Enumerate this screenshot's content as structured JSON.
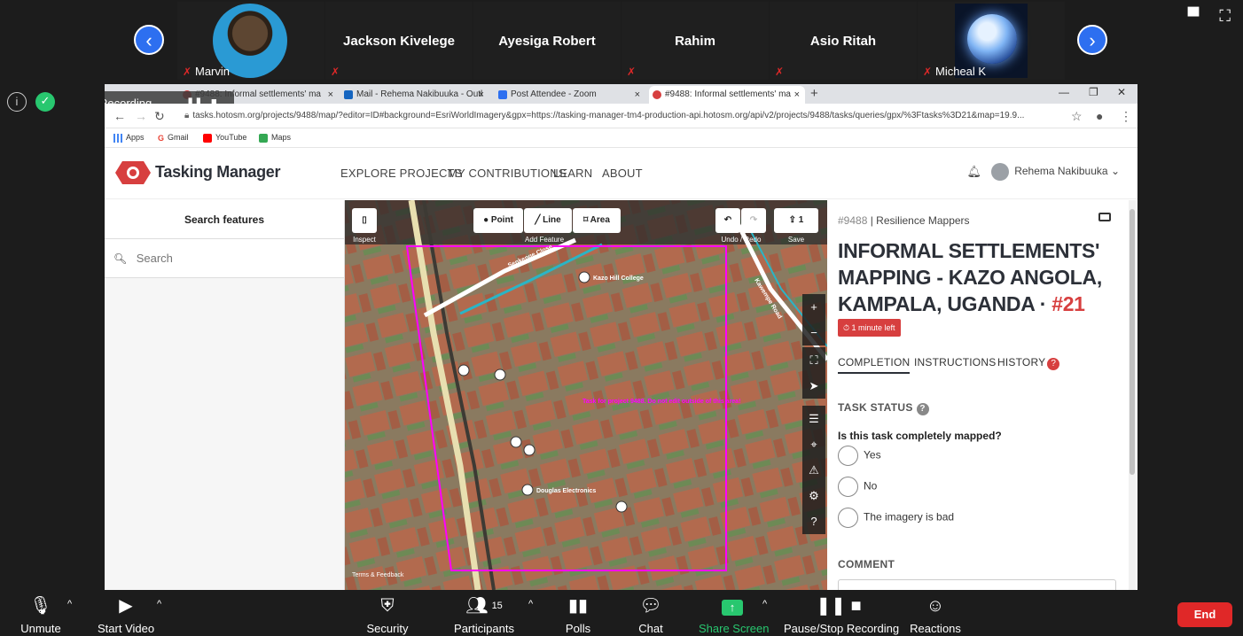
{
  "gallery": {
    "participants": [
      {
        "name": "Marvin",
        "has_video": true
      },
      {
        "name": "Jackson Kivelege"
      },
      {
        "name": "Ayesiga Robert"
      },
      {
        "name": "Rahim"
      },
      {
        "name": "Asio Ritah"
      },
      {
        "name": "Micheal K",
        "has_video": true
      }
    ],
    "prev_arrow": "‹",
    "next_arrow": "›"
  },
  "recording": {
    "label": "Recording..."
  },
  "browser": {
    "tabs": [
      {
        "label": "#9488: Informal settlements' ma"
      },
      {
        "label": "Mail - Rehema Nakibuuka - Outl"
      },
      {
        "label": "Post Attendee - Zoom"
      },
      {
        "label": "#9488: Informal settlements' ma"
      }
    ],
    "new_tab": "+",
    "url": "tasks.hotosm.org/projects/9488/map/?editor=ID#background=EsriWorldImagery&gpx=https://tasking-manager-tm4-production-api.hotosm.org/api/v2/projects/9488/tasks/queries/gpx/%3Ftasks%3D21&map=19.9...",
    "bookmarks": [
      {
        "label": "Apps",
        "color": "#4285f4"
      },
      {
        "label": "Gmail",
        "color": "#ea4335"
      },
      {
        "label": "YouTube",
        "color": "#ff0000"
      },
      {
        "label": "Maps",
        "color": "#34a853"
      }
    ]
  },
  "tm": {
    "title": "Tasking Manager",
    "nav": [
      "EXPLORE PROJECTS",
      "MY CONTRIBUTIONS",
      "LEARN",
      "ABOUT"
    ],
    "user_name": "Rehema Nakibuuka"
  },
  "search": {
    "header": "Search features",
    "placeholder": "Search"
  },
  "map": {
    "inspect_label": "Inspect",
    "point_label": "Point",
    "line_label": "Line",
    "area_label": "Area",
    "add_feature_label": "Add Feature",
    "undo_redo_label": "Undo / Redo",
    "save_label": "Save",
    "save_count": "1",
    "task_warning": "Task for project 9488. Do not edit outside of this area!",
    "poi_labels": [
      "Kazo Hill College",
      "Douglas Electronics"
    ],
    "road_labels": [
      "Senkenge Close",
      "Kawempe Road"
    ],
    "terms": "Terms & Feedback"
  },
  "task": {
    "project_id": "#9488",
    "org": "Resilience Mappers",
    "title_text": "INFORMAL SETTLEMENTS' MAPPING - KAZO ANGOLA, KAMPALA, UGANDA ·",
    "task_number": "#21",
    "time_left": "1 minute left",
    "tabs": [
      "COMPLETION",
      "INSTRUCTIONS",
      "HISTORY"
    ],
    "history_badge": "?",
    "status_label": "TASK STATUS",
    "question": "Is this task completely mapped?",
    "options": [
      "Yes",
      "No",
      "The imagery is bad"
    ],
    "comment_label": "COMMENT"
  },
  "toolbar": {
    "unmute": "Unmute",
    "start_video": "Start Video",
    "security": "Security",
    "participants": "Participants",
    "participants_count": "15",
    "polls": "Polls",
    "chat": "Chat",
    "share_screen": "Share Screen",
    "pause_stop": "Pause/Stop Recording",
    "reactions": "Reactions",
    "end": "End"
  },
  "colors": {
    "zoom_blue": "#2d6ff0",
    "share_green": "#28c76f",
    "end_red": "#e02828",
    "tm_red": "#d73f3f",
    "task_boundary": "#ff00ff"
  }
}
